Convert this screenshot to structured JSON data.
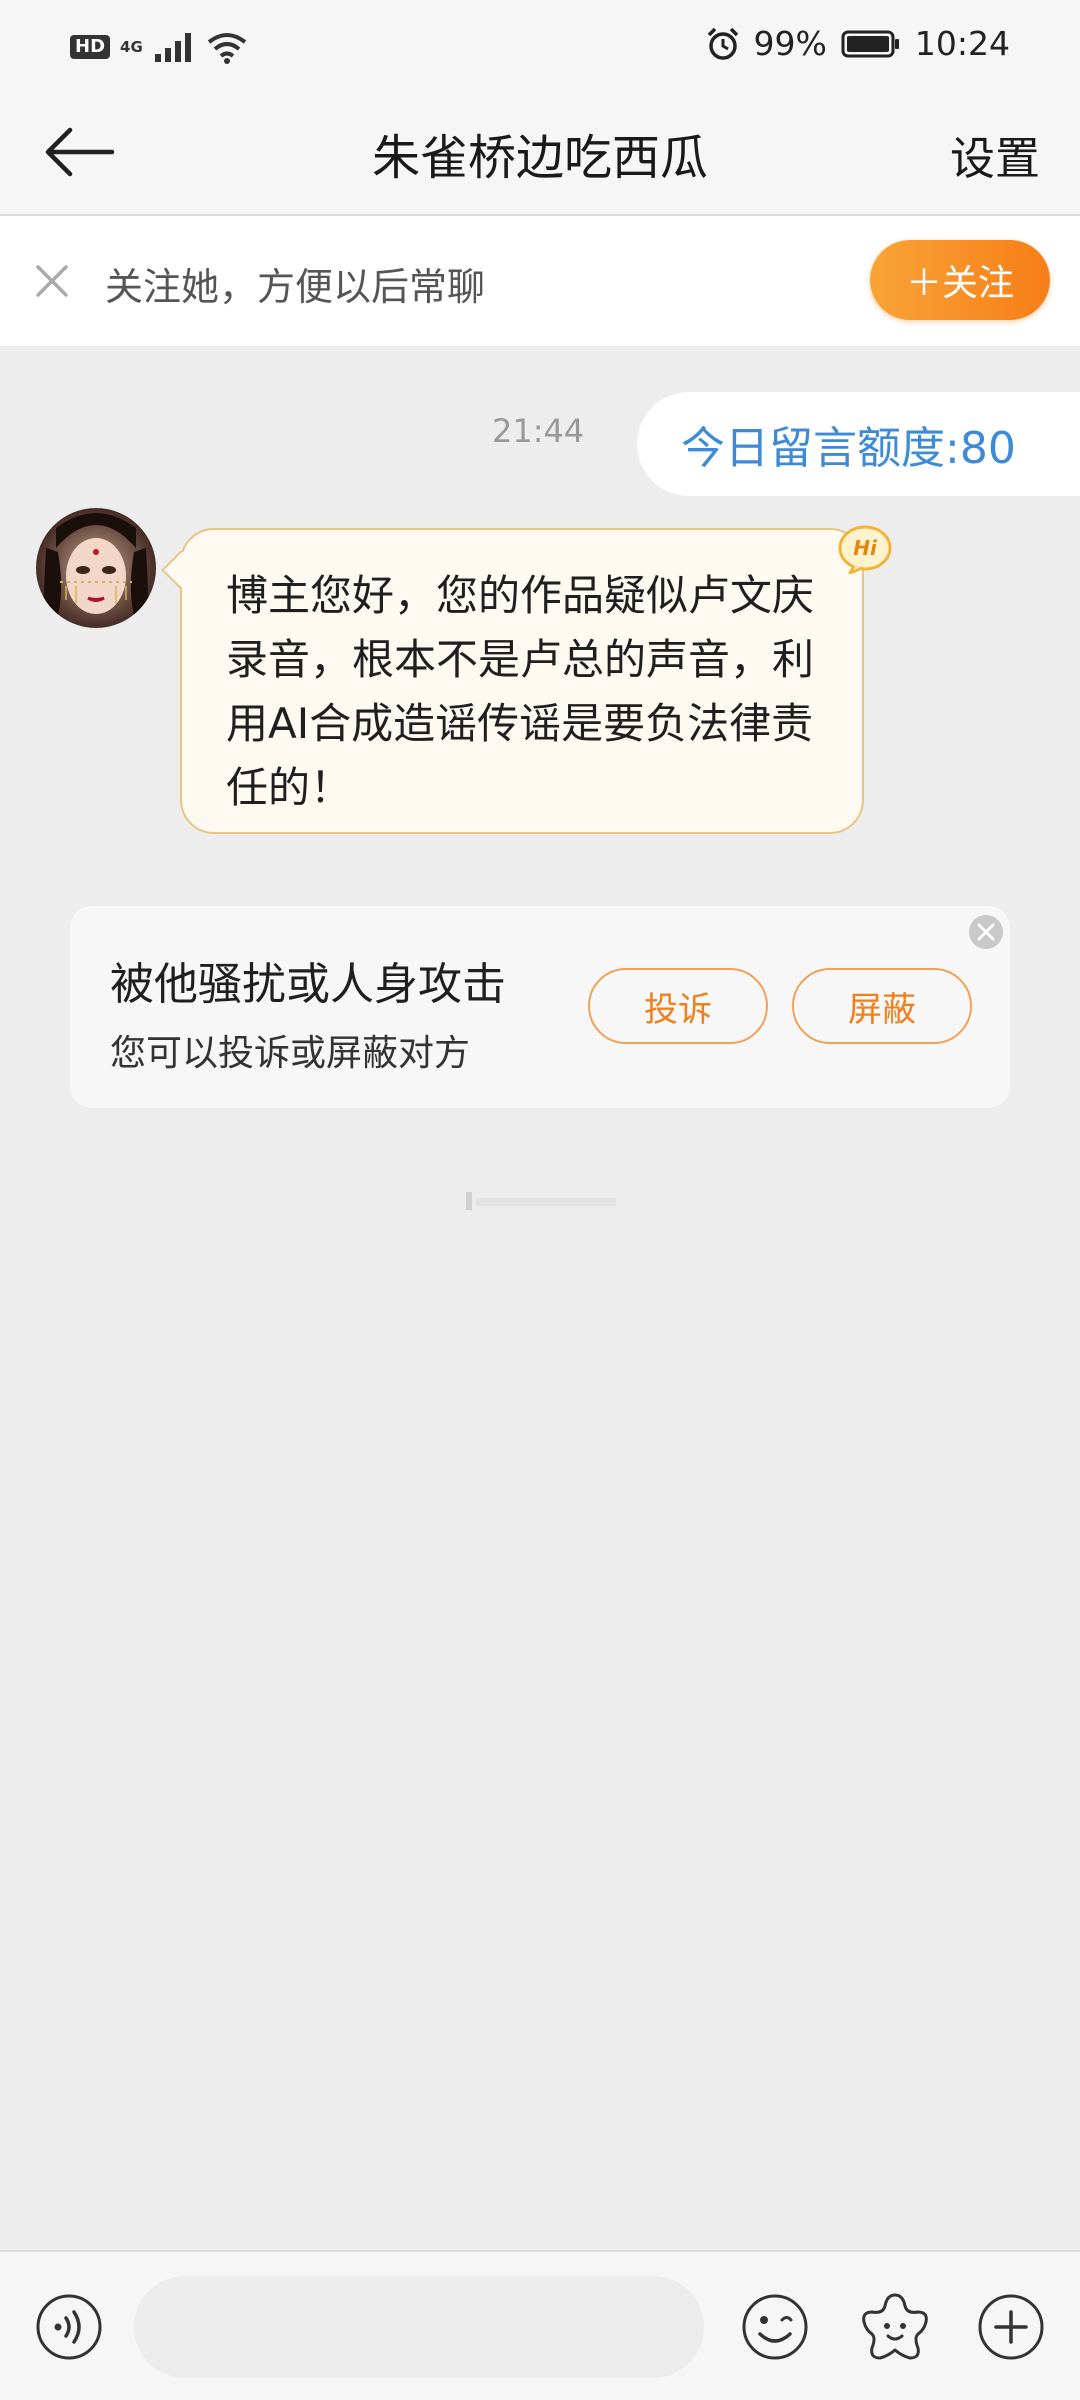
{
  "status_bar": {
    "hd_label": "HD",
    "network_label": "4G",
    "battery": "99%",
    "time": "10:24"
  },
  "header": {
    "title": "朱雀桥边吃西瓜",
    "settings_label": "设置"
  },
  "follow_bar": {
    "prompt": "关注她，方便以后常聊",
    "follow_button": "＋关注"
  },
  "chat": {
    "timestamp": "21:44",
    "quota_text": "今日留言额度:80",
    "message": "博主您好，您的作品疑似卢文庆录音，根本不是卢总的声音，利用AI合成造谣传谣是要负法律责任的！",
    "hi_badge": "Hi"
  },
  "harassment_card": {
    "title": "被他骚扰或人身攻击",
    "subtitle": "您可以投诉或屏蔽对方",
    "report_button": "投诉",
    "block_button": "屏蔽"
  },
  "input_bar": {
    "placeholder": ""
  },
  "colors": {
    "accent_orange": "#f77e18",
    "quota_blue": "#3d8bd6",
    "background": "#ededed",
    "bubble_border": "#e8c486"
  }
}
